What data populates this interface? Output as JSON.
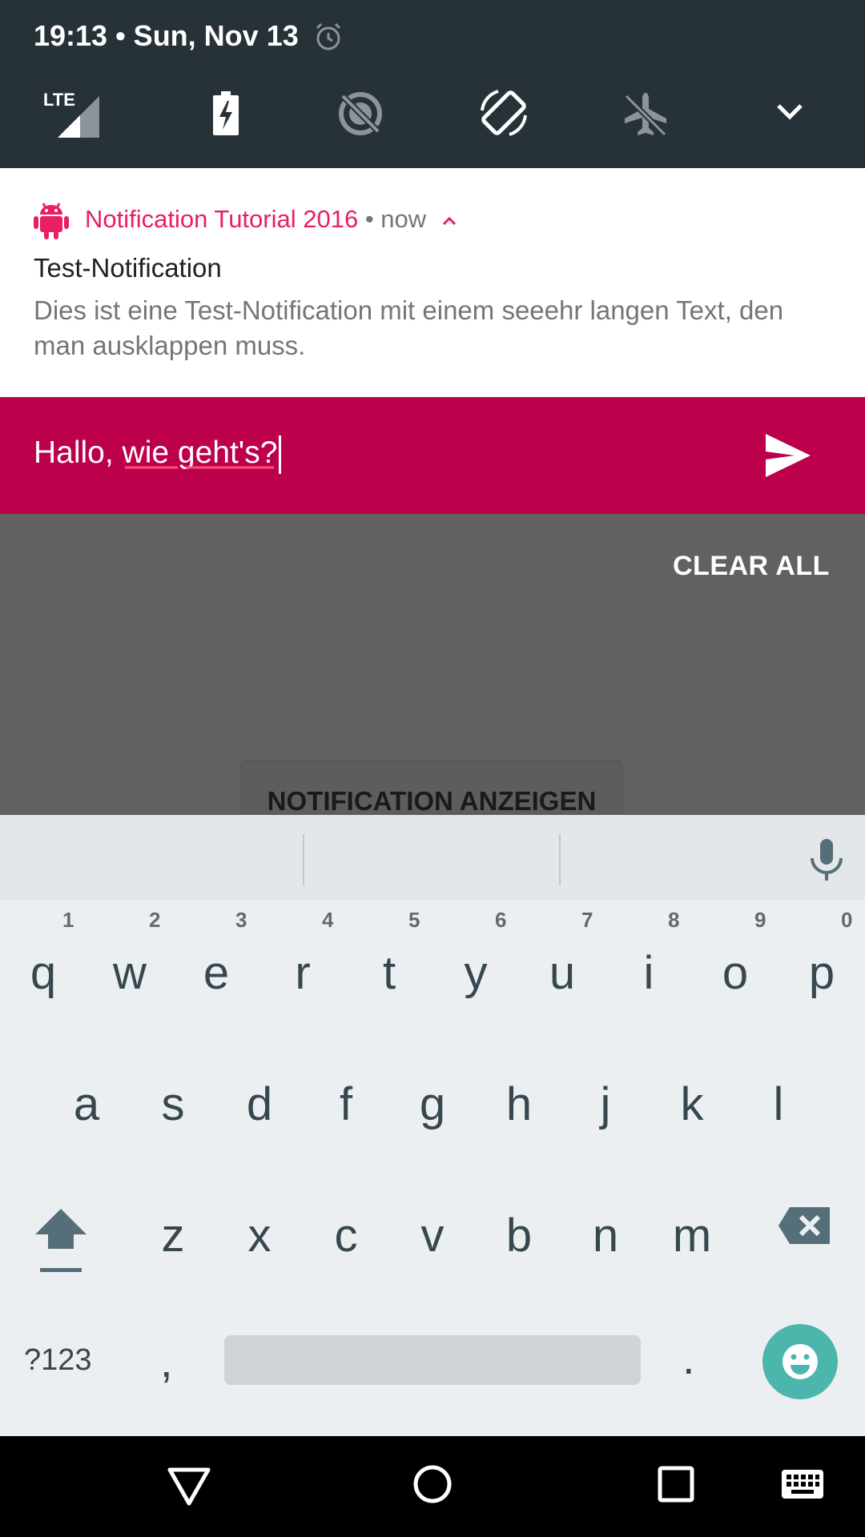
{
  "status": {
    "time_date": "19:13 • Sun, Nov 13",
    "network": "LTE"
  },
  "quick_settings": {
    "tiles": [
      "signal-icon",
      "battery-charging-icon",
      "data-saver-off-icon",
      "auto-rotate-icon",
      "airplane-mode-icon",
      "expand-icon"
    ]
  },
  "notification": {
    "app_name": "Notification Tutorial 2016",
    "separator": " • ",
    "time": "now",
    "title": "Test-Notification",
    "text": "Dies ist eine Test-Notification mit einem seeehr langen Text, den man ausklappen muss.",
    "accent_color": "#e91e63"
  },
  "reply": {
    "input_value": "Hallo, wie geht's?",
    "bar_color": "#bc004b"
  },
  "clear_all_label": "CLEAR ALL",
  "app_button_label": "NOTIFICATION ANZEIGEN",
  "keyboard": {
    "row1": [
      "q",
      "w",
      "e",
      "r",
      "t",
      "y",
      "u",
      "i",
      "o",
      "p"
    ],
    "row1_hints": [
      "1",
      "2",
      "3",
      "4",
      "5",
      "6",
      "7",
      "8",
      "9",
      "0"
    ],
    "row2": [
      "a",
      "s",
      "d",
      "f",
      "g",
      "h",
      "j",
      "k",
      "l"
    ],
    "row3": [
      "z",
      "x",
      "c",
      "v",
      "b",
      "n",
      "m"
    ],
    "symbols_label": "?123",
    "comma_label": ",",
    "period_label": "."
  }
}
